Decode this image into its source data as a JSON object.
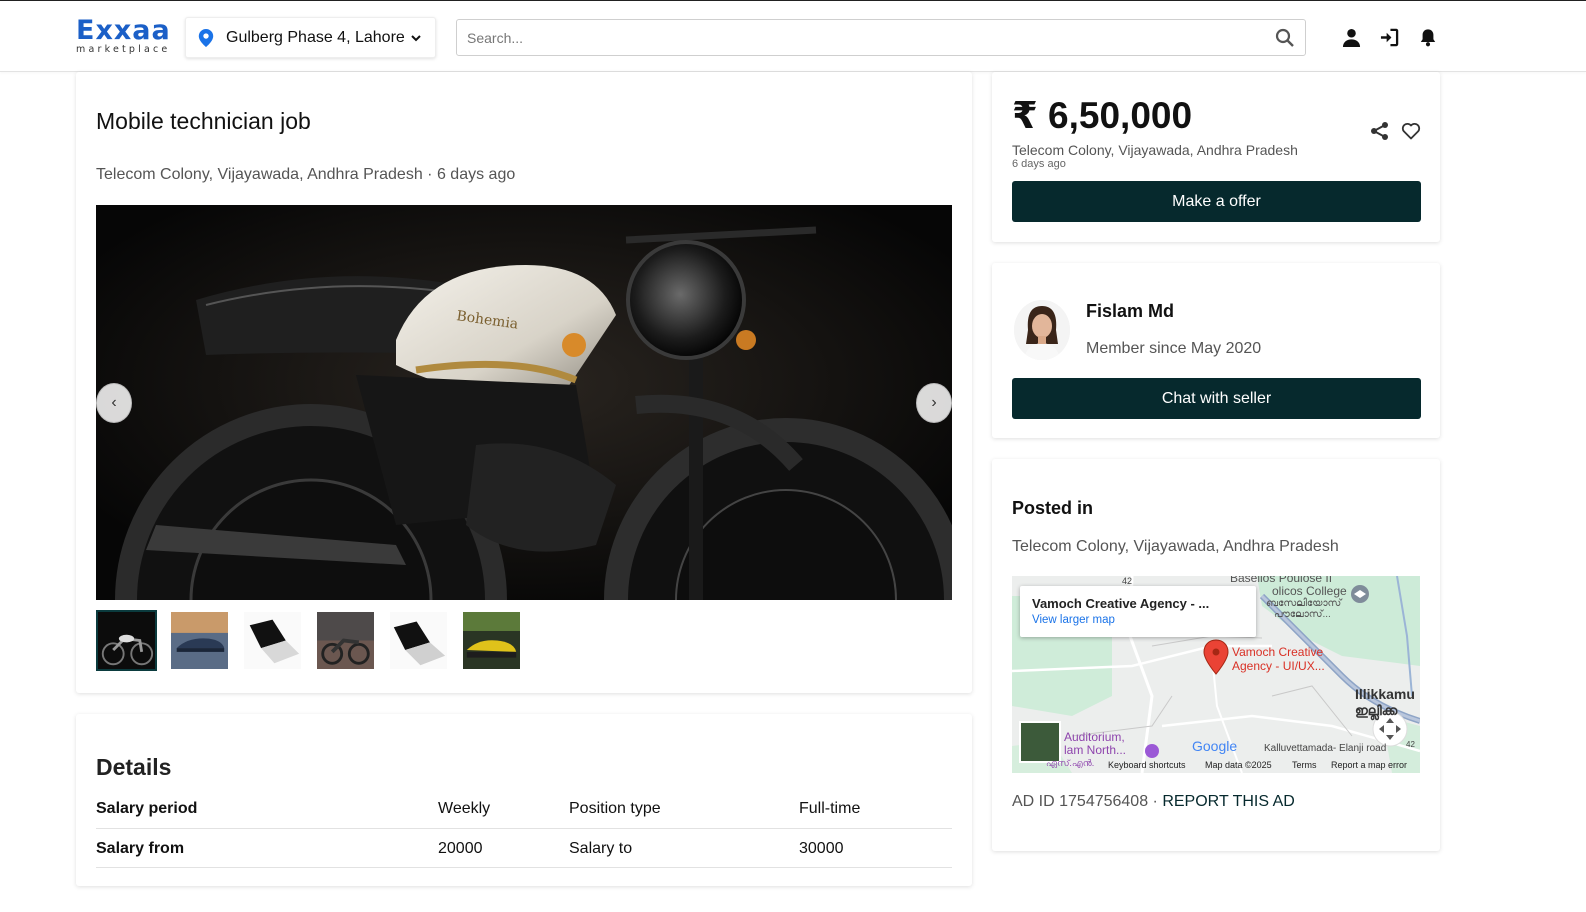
{
  "header": {
    "logo_main": "Exxaa",
    "logo_sub": "marketplace",
    "location": "Gulberg Phase 4, Lahore",
    "search_placeholder": "Search...",
    "icons": [
      "user-icon",
      "login-icon",
      "bell-icon"
    ]
  },
  "listing": {
    "title": "Mobile technician job",
    "location": "Telecom Colony, Vijayawada, Andhra Pradesh",
    "time_ago": "6 days ago",
    "prev_label": "‹",
    "next_label": "›"
  },
  "details": {
    "title": "Details",
    "rows": [
      {
        "k1": "Salary period",
        "v1": "Weekly",
        "k2": "Position type",
        "v2": "Full-time"
      },
      {
        "k1": "Salary from",
        "v1": "20000",
        "k2": "Salary to",
        "v2": "30000"
      }
    ]
  },
  "price_card": {
    "price": "₹ 6,50,000",
    "location": "Telecom Colony, Vijayawada, Andhra Pradesh",
    "time_ago": "6 days ago",
    "offer_label": "Make a offer"
  },
  "seller": {
    "name": "Fislam Md",
    "since": "Member since May 2020",
    "chat_label": "Chat with seller"
  },
  "posted": {
    "title": "Posted in",
    "location": "Telecom Colony, Vijayawada, Andhra Pradesh",
    "map": {
      "popup_title": "Vamoch Creative Agency - ...",
      "popup_link": "View larger map",
      "pin_label_1": "Vamoch Creative",
      "pin_label_2": "Agency - UI/UX...",
      "label_top": "Basellos Poulose II",
      "label_college": "olicos College",
      "label_malayalam_1": "ബസേലിയോസ്",
      "label_malayalam_2": "പൗലോസ്...",
      "label_right": "Illikkamu",
      "label_right_2": "ഇല്ലിക്ക",
      "label_aud_1": "Auditorium,",
      "label_aud_2": "lam North...",
      "label_aud_3": "ഏസ്.എൻ.",
      "label_road": "Kalluvettamada- Elanji road",
      "google": "Google",
      "road_42": "42",
      "foot_shortcuts": "Keyboard shortcuts",
      "foot_data": "Map data ©2025",
      "foot_terms": "Terms",
      "foot_report": "Report a map error"
    },
    "ad_id": "AD ID 1754756408",
    "sep": " · ",
    "report": "REPORT THIS AD"
  },
  "colors": {
    "brand": "#1b5fc7",
    "button_dark": "#06292d",
    "map_pin": "#ea4335"
  }
}
